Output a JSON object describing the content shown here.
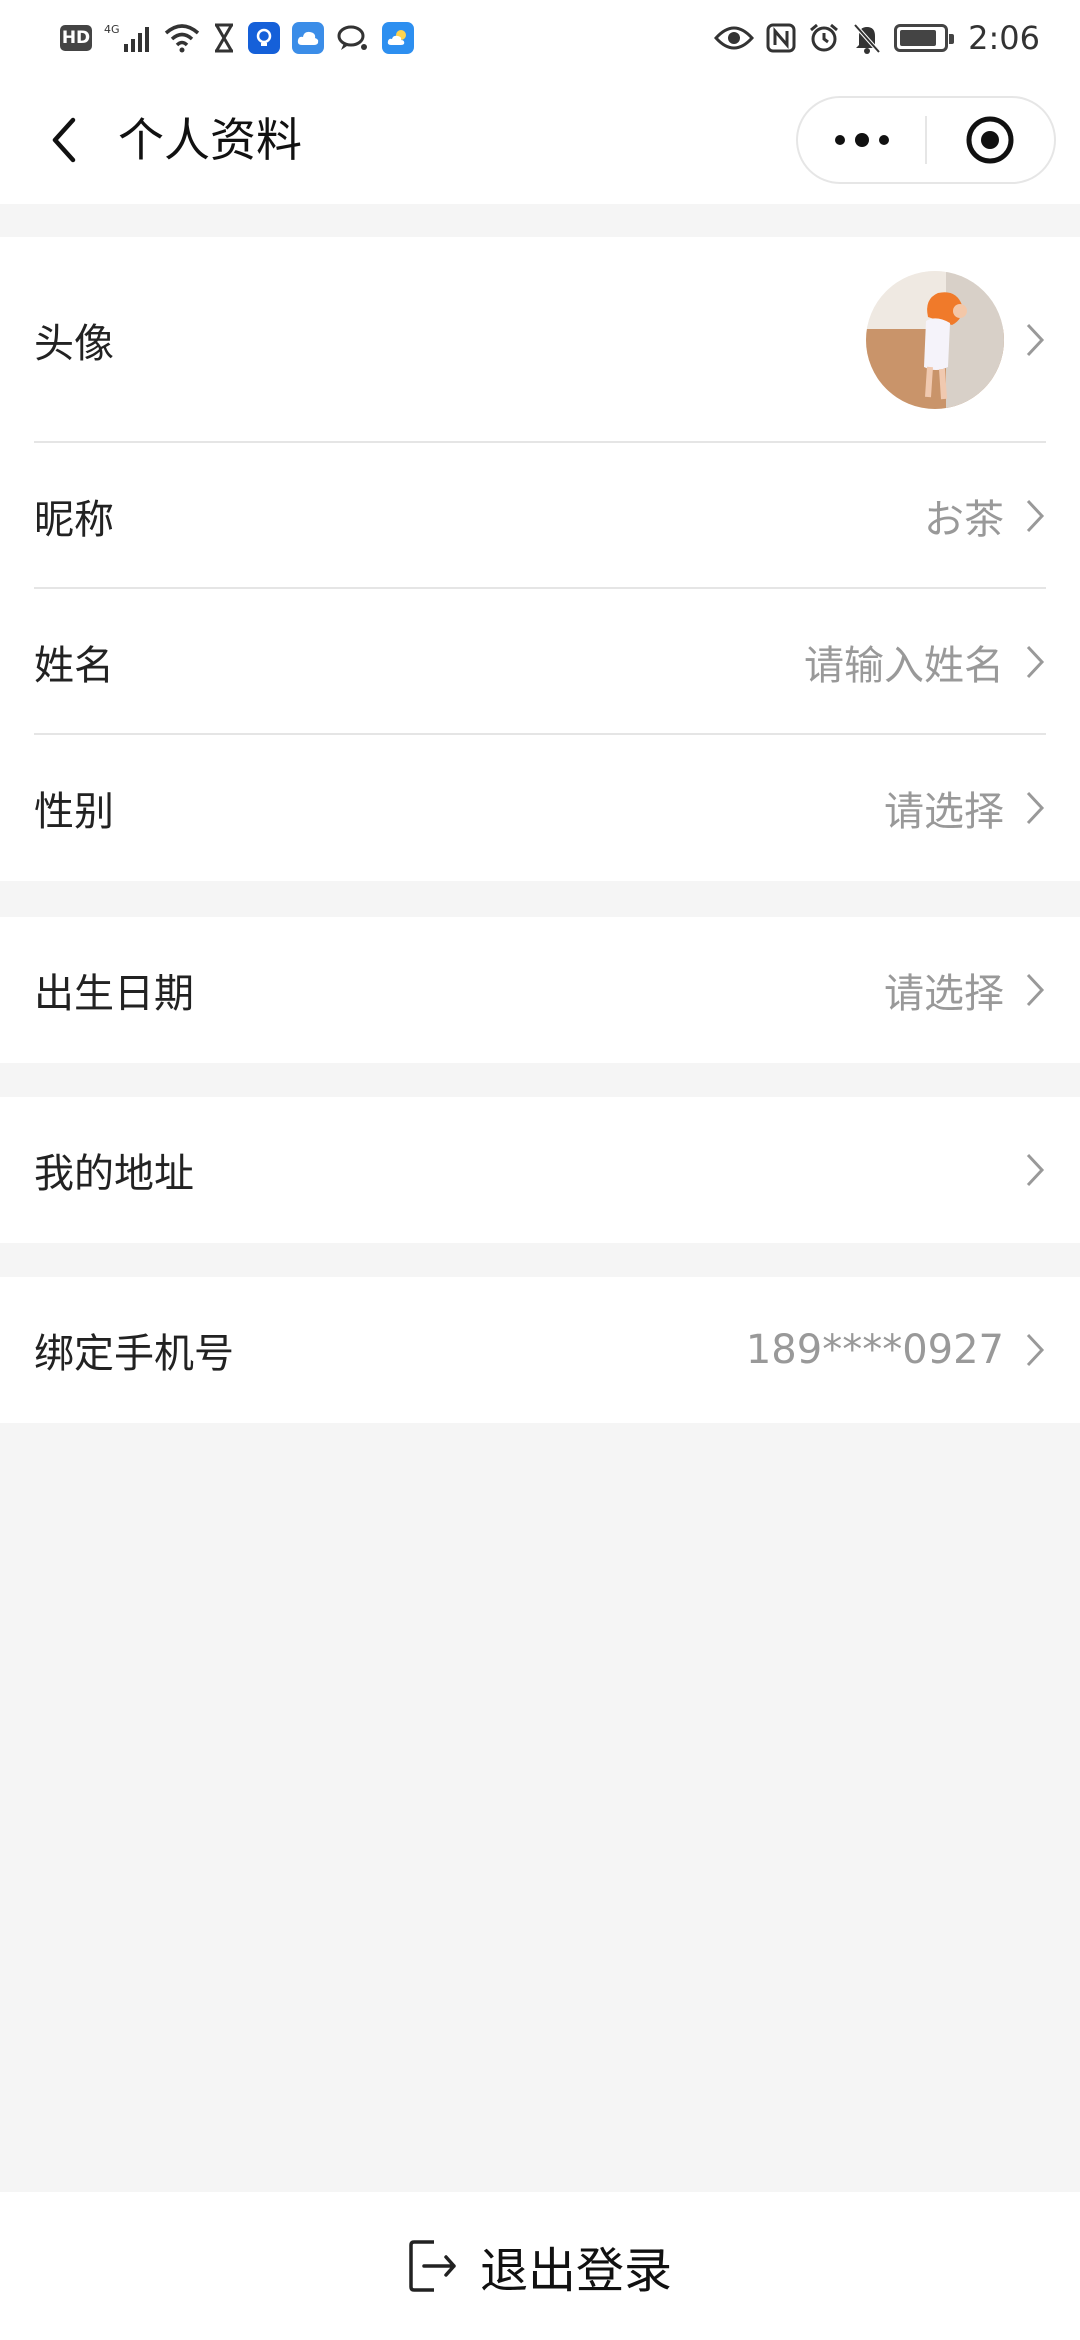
{
  "status_bar": {
    "time": "2:06",
    "left_icons": [
      "hd-icon",
      "4g-signal-icon",
      "wifi-icon",
      "hourglass-icon",
      "app-notification-icon",
      "cloud-app-icon",
      "chat-bubble-icon",
      "weather-app-icon"
    ],
    "right_icons": [
      "eye-icon",
      "nfc-icon",
      "alarm-icon",
      "mute-bell-icon",
      "battery-icon"
    ],
    "hd_label": "HD",
    "network_label": "4G"
  },
  "nav": {
    "title": "个人资料",
    "back_icon": "chevron-left-icon",
    "menu_icon": "more-dots-icon",
    "close_icon": "target-close-icon"
  },
  "profile": {
    "avatar_label": "头像",
    "nickname_label": "昵称",
    "nickname_value": "お茶",
    "name_label": "姓名",
    "name_placeholder": "请输入姓名",
    "gender_label": "性别",
    "gender_value": "请选择"
  },
  "birthday": {
    "label": "出生日期",
    "value": "请选择"
  },
  "address": {
    "label": "我的地址"
  },
  "phone": {
    "label": "绑定手机号",
    "value": "189****0927"
  },
  "footer": {
    "logout_label": "退出登录",
    "logout_icon": "logout-icon"
  },
  "colors": {
    "background": "#f5f5f5",
    "card": "#ffffff",
    "text": "#222222",
    "muted": "#999999",
    "divider": "#e5e5e5"
  }
}
